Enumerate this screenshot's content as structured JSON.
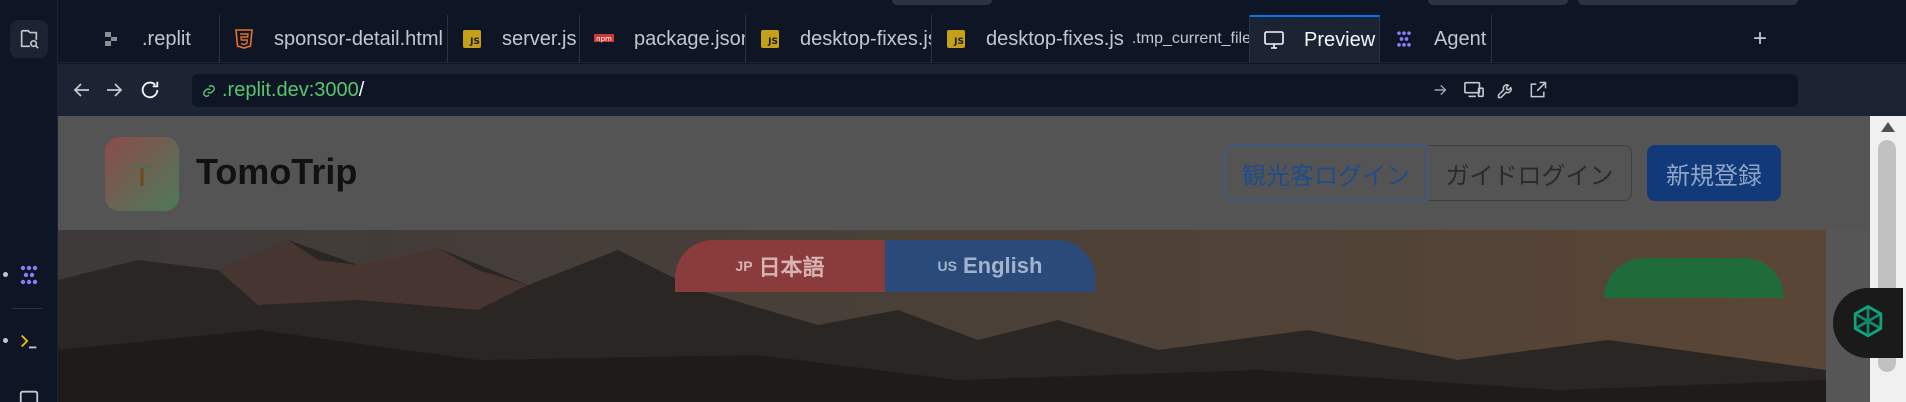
{
  "tabs": [
    {
      "label": ".replit",
      "icon": "replit-config-icon"
    },
    {
      "label": "sponsor-detail.html",
      "icon": "html5-icon"
    },
    {
      "label": "server.js",
      "icon": "js-icon"
    },
    {
      "label": "package.json",
      "icon": "npm-icon"
    },
    {
      "label": "desktop-fixes.js",
      "icon": "js-icon"
    },
    {
      "label": "desktop-fixes.js",
      "sub": ".tmp_current_files/",
      "icon": "js-icon"
    },
    {
      "label": "Preview",
      "icon": "monitor-icon",
      "active": true
    },
    {
      "label": "Agent",
      "icon": "agent-icon"
    }
  ],
  "js_badge": "JS",
  "npm_badge": "npm",
  "new_tab": "+",
  "address": {
    "host": ".replit.dev:3000",
    "path": "/"
  },
  "site": {
    "brand": "TomoTrip",
    "tourist_login": "観光客ログイン",
    "guide_login": "ガイドログイン",
    "signup": "新規登録",
    "lang_jp_flag": "JP",
    "lang_jp": "日本語",
    "lang_en_flag": "US",
    "lang_en": "English"
  },
  "colors": {
    "accent": "#0079f2",
    "url_host": "#58c66e",
    "agent_purple": "#8b7cf6",
    "ai_green": "#10a37f"
  }
}
